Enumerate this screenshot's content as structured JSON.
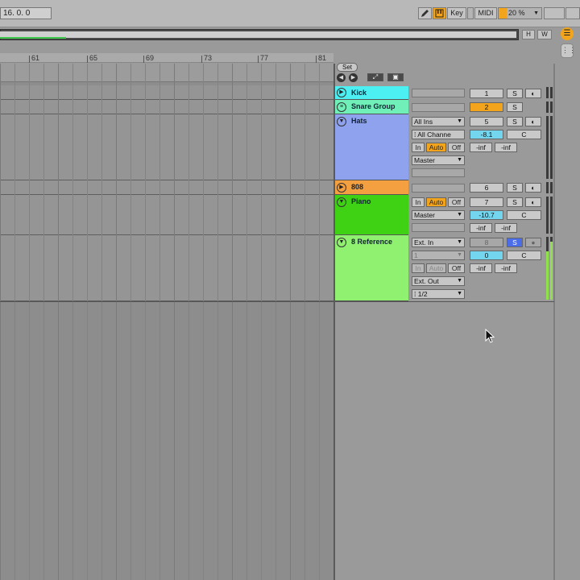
{
  "transport": {
    "position": "16.  0.  0"
  },
  "toolbar": {
    "draw_icon": "pencil-icon",
    "keys_icon": "piano-keys-icon",
    "key_label": "Key",
    "midi_label": "MIDI",
    "zoom_value": "20 %",
    "h_label": "H",
    "w_label": "W",
    "accent": "#f2a51c"
  },
  "ruler": {
    "labels": [
      "61",
      "65",
      "69",
      "73",
      "77",
      "81"
    ]
  },
  "session": {
    "set_label": "Set",
    "tracks": [
      {
        "name": "Kick",
        "color": "#4cf0f2",
        "number": "1",
        "solo": "S"
      },
      {
        "name": "Snare Group",
        "color": "#70f0b8",
        "number": "2",
        "solo": "S"
      },
      {
        "name": "Hats",
        "color": "#8fa2ee",
        "input_type": "All Ins",
        "input_channel": "All Channe",
        "monitor": [
          "In",
          "Auto",
          "Off"
        ],
        "output": "Master",
        "number": "5",
        "solo": "S",
        "volume": "-8.1",
        "pan": "C",
        "send_a": "-inf",
        "send_b": "-inf"
      },
      {
        "name": "808",
        "color": "#f5a040",
        "number": "6",
        "solo": "S"
      },
      {
        "name": "Piano",
        "color": "#3fd214",
        "monitor": [
          "In",
          "Auto",
          "Off"
        ],
        "output": "Master",
        "number": "7",
        "solo": "S",
        "volume": "-10.7",
        "pan": "C",
        "send_a": "-inf",
        "send_b": "-inf"
      },
      {
        "name": "8 Reference",
        "color": "#90f070",
        "input_type": "Ext. In",
        "input_channel": "1",
        "monitor": [
          "In",
          "Auto",
          "Off"
        ],
        "output": "Ext. Out",
        "output_channel": "1/2",
        "number": "8",
        "solo": "S",
        "volume": "0",
        "pan": "C",
        "send_a": "-inf",
        "send_b": "-inf"
      }
    ]
  }
}
